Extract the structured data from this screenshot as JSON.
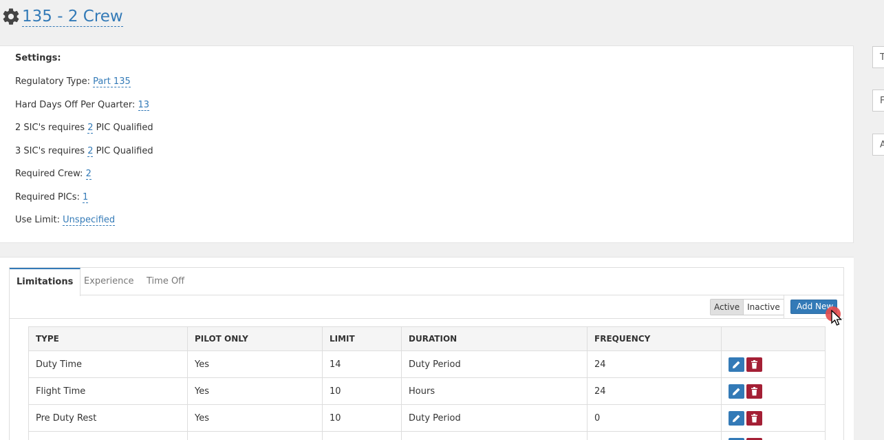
{
  "header": {
    "title": "135 - 2 Crew",
    "icon": "gear-icon"
  },
  "settings": {
    "heading": "Settings:",
    "regulatory_type": {
      "label": "Regulatory Type:",
      "value": "Part 135"
    },
    "hard_days_off": {
      "label": "Hard Days Off Per Quarter:",
      "value": "13"
    },
    "sic2": {
      "prefix": "2 SIC's requires",
      "value": "2",
      "suffix": "PIC Qualified"
    },
    "sic3": {
      "prefix": "3 SIC's requires",
      "value": "2",
      "suffix": "PIC Qualified"
    },
    "required_crew": {
      "label": "Required Crew:",
      "value": "2"
    },
    "required_pics": {
      "label": "Required PICs:",
      "value": "1"
    },
    "use_limit": {
      "label": "Use Limit:",
      "value": "Unspecified"
    }
  },
  "side_boxes": [
    "T",
    "F",
    "A"
  ],
  "tabs": [
    {
      "label": "Limitations",
      "active": true
    },
    {
      "label": "Experience",
      "active": false
    },
    {
      "label": "Time Off",
      "active": false
    }
  ],
  "toolbar": {
    "active_label": "Active",
    "inactive_label": "Inactive",
    "add_label": "Add New"
  },
  "table": {
    "columns": [
      "TYPE",
      "PILOT ONLY",
      "LIMIT",
      "DURATION",
      "FREQUENCY",
      ""
    ],
    "rows": [
      {
        "type": "Duty Time",
        "pilot_only": "Yes",
        "limit": "14",
        "duration": "Duty Period",
        "frequency": "24"
      },
      {
        "type": "Flight Time",
        "pilot_only": "Yes",
        "limit": "10",
        "duration": "Hours",
        "frequency": "24"
      },
      {
        "type": "Pre Duty Rest",
        "pilot_only": "Yes",
        "limit": "10",
        "duration": "Duty Period",
        "frequency": "0"
      },
      {
        "type": "",
        "pilot_only": "",
        "limit": "",
        "duration": "",
        "frequency": ""
      }
    ]
  },
  "colors": {
    "link": "#337ab7",
    "danger": "#a41f35",
    "background": "#f0f0f0"
  }
}
